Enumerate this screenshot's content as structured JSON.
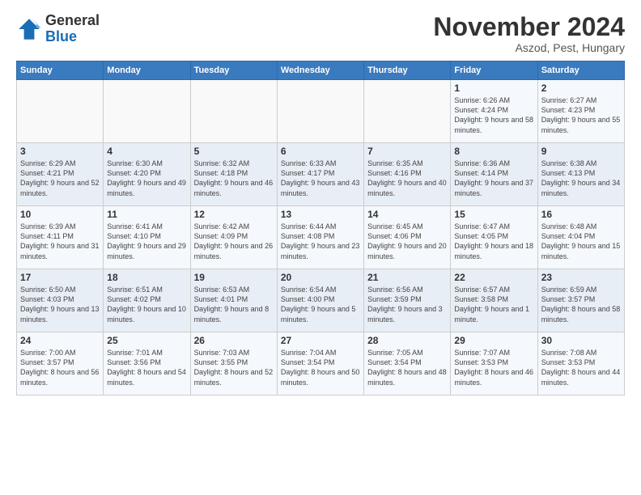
{
  "logo": {
    "general": "General",
    "blue": "Blue"
  },
  "header": {
    "title": "November 2024",
    "location": "Aszod, Pest, Hungary"
  },
  "days_of_week": [
    "Sunday",
    "Monday",
    "Tuesday",
    "Wednesday",
    "Thursday",
    "Friday",
    "Saturday"
  ],
  "weeks": [
    [
      {
        "day": "",
        "info": ""
      },
      {
        "day": "",
        "info": ""
      },
      {
        "day": "",
        "info": ""
      },
      {
        "day": "",
        "info": ""
      },
      {
        "day": "",
        "info": ""
      },
      {
        "day": "1",
        "info": "Sunrise: 6:26 AM\nSunset: 4:24 PM\nDaylight: 9 hours and 58 minutes."
      },
      {
        "day": "2",
        "info": "Sunrise: 6:27 AM\nSunset: 4:23 PM\nDaylight: 9 hours and 55 minutes."
      }
    ],
    [
      {
        "day": "3",
        "info": "Sunrise: 6:29 AM\nSunset: 4:21 PM\nDaylight: 9 hours and 52 minutes."
      },
      {
        "day": "4",
        "info": "Sunrise: 6:30 AM\nSunset: 4:20 PM\nDaylight: 9 hours and 49 minutes."
      },
      {
        "day": "5",
        "info": "Sunrise: 6:32 AM\nSunset: 4:18 PM\nDaylight: 9 hours and 46 minutes."
      },
      {
        "day": "6",
        "info": "Sunrise: 6:33 AM\nSunset: 4:17 PM\nDaylight: 9 hours and 43 minutes."
      },
      {
        "day": "7",
        "info": "Sunrise: 6:35 AM\nSunset: 4:16 PM\nDaylight: 9 hours and 40 minutes."
      },
      {
        "day": "8",
        "info": "Sunrise: 6:36 AM\nSunset: 4:14 PM\nDaylight: 9 hours and 37 minutes."
      },
      {
        "day": "9",
        "info": "Sunrise: 6:38 AM\nSunset: 4:13 PM\nDaylight: 9 hours and 34 minutes."
      }
    ],
    [
      {
        "day": "10",
        "info": "Sunrise: 6:39 AM\nSunset: 4:11 PM\nDaylight: 9 hours and 31 minutes."
      },
      {
        "day": "11",
        "info": "Sunrise: 6:41 AM\nSunset: 4:10 PM\nDaylight: 9 hours and 29 minutes."
      },
      {
        "day": "12",
        "info": "Sunrise: 6:42 AM\nSunset: 4:09 PM\nDaylight: 9 hours and 26 minutes."
      },
      {
        "day": "13",
        "info": "Sunrise: 6:44 AM\nSunset: 4:08 PM\nDaylight: 9 hours and 23 minutes."
      },
      {
        "day": "14",
        "info": "Sunrise: 6:45 AM\nSunset: 4:06 PM\nDaylight: 9 hours and 20 minutes."
      },
      {
        "day": "15",
        "info": "Sunrise: 6:47 AM\nSunset: 4:05 PM\nDaylight: 9 hours and 18 minutes."
      },
      {
        "day": "16",
        "info": "Sunrise: 6:48 AM\nSunset: 4:04 PM\nDaylight: 9 hours and 15 minutes."
      }
    ],
    [
      {
        "day": "17",
        "info": "Sunrise: 6:50 AM\nSunset: 4:03 PM\nDaylight: 9 hours and 13 minutes."
      },
      {
        "day": "18",
        "info": "Sunrise: 6:51 AM\nSunset: 4:02 PM\nDaylight: 9 hours and 10 minutes."
      },
      {
        "day": "19",
        "info": "Sunrise: 6:53 AM\nSunset: 4:01 PM\nDaylight: 9 hours and 8 minutes."
      },
      {
        "day": "20",
        "info": "Sunrise: 6:54 AM\nSunset: 4:00 PM\nDaylight: 9 hours and 5 minutes."
      },
      {
        "day": "21",
        "info": "Sunrise: 6:56 AM\nSunset: 3:59 PM\nDaylight: 9 hours and 3 minutes."
      },
      {
        "day": "22",
        "info": "Sunrise: 6:57 AM\nSunset: 3:58 PM\nDaylight: 9 hours and 1 minute."
      },
      {
        "day": "23",
        "info": "Sunrise: 6:59 AM\nSunset: 3:57 PM\nDaylight: 8 hours and 58 minutes."
      }
    ],
    [
      {
        "day": "24",
        "info": "Sunrise: 7:00 AM\nSunset: 3:57 PM\nDaylight: 8 hours and 56 minutes."
      },
      {
        "day": "25",
        "info": "Sunrise: 7:01 AM\nSunset: 3:56 PM\nDaylight: 8 hours and 54 minutes."
      },
      {
        "day": "26",
        "info": "Sunrise: 7:03 AM\nSunset: 3:55 PM\nDaylight: 8 hours and 52 minutes."
      },
      {
        "day": "27",
        "info": "Sunrise: 7:04 AM\nSunset: 3:54 PM\nDaylight: 8 hours and 50 minutes."
      },
      {
        "day": "28",
        "info": "Sunrise: 7:05 AM\nSunset: 3:54 PM\nDaylight: 8 hours and 48 minutes."
      },
      {
        "day": "29",
        "info": "Sunrise: 7:07 AM\nSunset: 3:53 PM\nDaylight: 8 hours and 46 minutes."
      },
      {
        "day": "30",
        "info": "Sunrise: 7:08 AM\nSunset: 3:53 PM\nDaylight: 8 hours and 44 minutes."
      }
    ]
  ]
}
